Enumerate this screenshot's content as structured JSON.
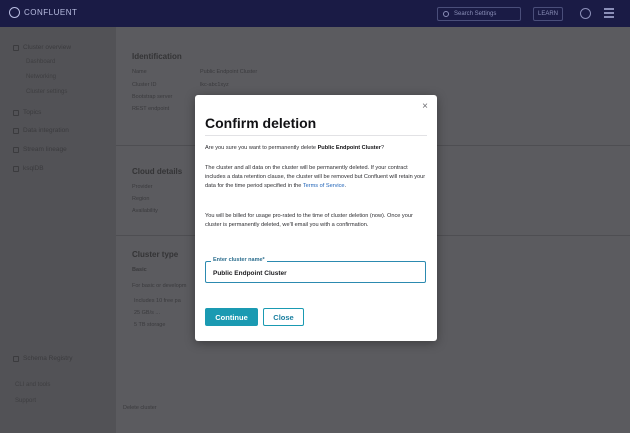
{
  "topbar": {
    "brand": "CONFLUENT",
    "search_placeholder": "Search Settings",
    "button_label": "LEARN"
  },
  "sidebar": {
    "items": [
      {
        "label": "Cluster overview"
      },
      {
        "label": "Topics"
      },
      {
        "label": "Data integration"
      },
      {
        "label": "Stream lineage"
      },
      {
        "label": "ksqlDB"
      },
      {
        "label": "Schema Registry"
      }
    ],
    "subitems": [
      "Dashboard",
      "Networking",
      "Cluster settings"
    ],
    "footer": [
      "CLI and tools",
      "Support"
    ]
  },
  "background": {
    "identification_heading": "Identification",
    "identification_rows": [
      "Name",
      "Cluster ID",
      "Bootstrap server",
      "REST endpoint"
    ],
    "identification_values": [
      "Public Endpoint Cluster",
      "lkc-abc1xyz"
    ],
    "cloud_heading": "Cloud details",
    "cloud_rows": [
      "Provider",
      "Region",
      "Availability"
    ],
    "cluster_type_heading": "Cluster type",
    "cluster_type_value": "Basic",
    "cluster_type_desc": "For basic or developm",
    "cluster_type_bullets": [
      "Includes 10 free pa",
      "25 GB/s ...",
      "5 TB storage"
    ],
    "delete_link": "Delete cluster"
  },
  "modal": {
    "title": "Confirm deletion",
    "close_glyph": "×",
    "intro_prefix": "Are you sure you want to permanently delete ",
    "cluster_name": "Public Endpoint Cluster",
    "intro_suffix": "?",
    "retention_text": "The cluster and all data on the cluster will be permanently deleted. If your contract includes a data retention clause, the cluster will be removed but Confluent will retain your data for the time period specified in the ",
    "terms_link": "Terms of Service",
    "retention_end": ".",
    "billing_text": "You will be billed for usage pro-rated to the time of cluster deletion (now). Once your cluster is permanently deleted, we'll email you with a confirmation.",
    "field_label": "Enter cluster name*",
    "field_value": "Public Endpoint Cluster",
    "continue_label": "Continue",
    "close_label": "Close"
  },
  "colors": {
    "accent": "#1a9ab2",
    "topbar": "#1a1b45",
    "link": "#1f63b8"
  }
}
